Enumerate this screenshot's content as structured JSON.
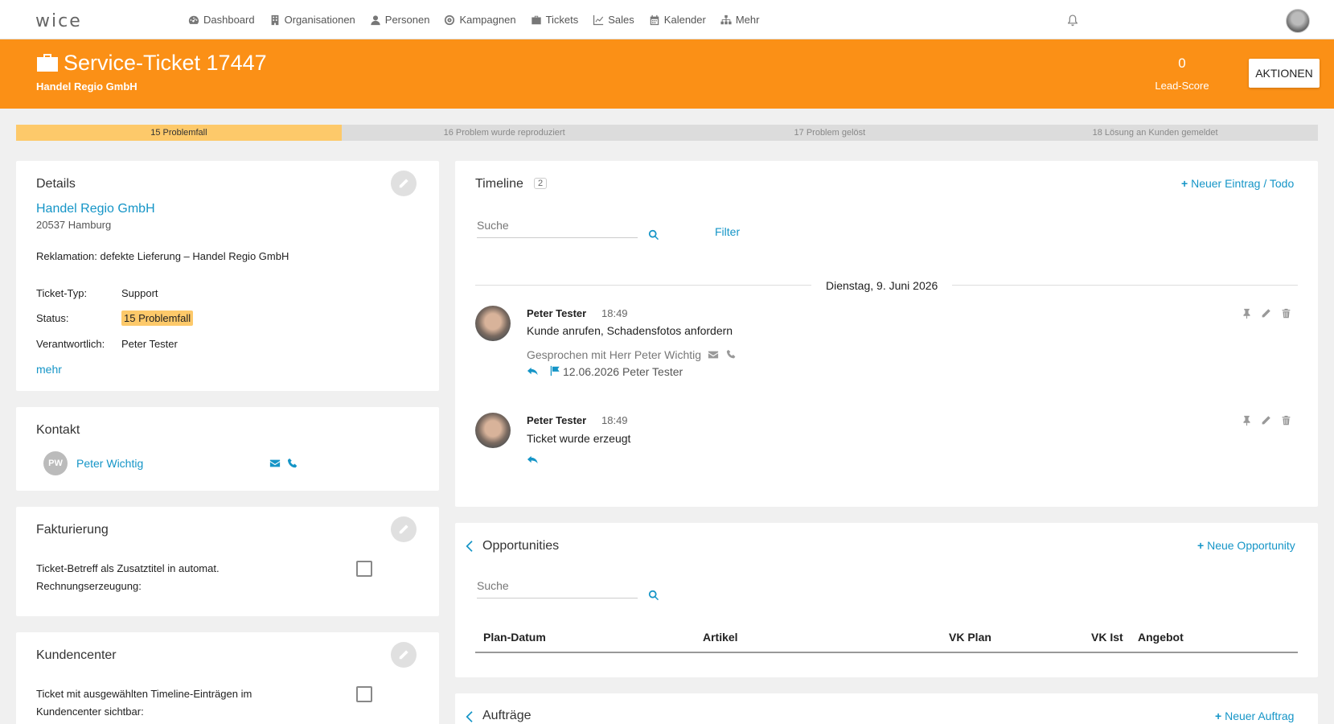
{
  "app": {
    "logo": "wice"
  },
  "nav": [
    {
      "label": "Dashboard",
      "icon": "dashboard-icon"
    },
    {
      "label": "Organisationen",
      "icon": "building-icon"
    },
    {
      "label": "Personen",
      "icon": "person-icon"
    },
    {
      "label": "Kampagnen",
      "icon": "target-icon"
    },
    {
      "label": "Tickets",
      "icon": "briefcase-icon"
    },
    {
      "label": "Sales",
      "icon": "chart-icon"
    },
    {
      "label": "Kalender",
      "icon": "calendar-icon"
    },
    {
      "label": "Mehr",
      "icon": "sitemap-icon"
    }
  ],
  "header": {
    "title": "Service-Ticket 17447",
    "subtitle": "Handel Regio GmbH",
    "lead_score_value": "0",
    "lead_score_label": "Lead-Score",
    "actions_label": "AKTIONEN",
    "accent": "#fb9016"
  },
  "stages": [
    {
      "label": "15 Problemfall",
      "active": true
    },
    {
      "label": "16 Problem wurde reproduziert",
      "active": false
    },
    {
      "label": "17 Problem gelöst",
      "active": false
    },
    {
      "label": "18 Lösung an Kunden gemeldet",
      "active": false
    }
  ],
  "details": {
    "title": "Details",
    "org_name": "Handel Regio GmbH",
    "org_address": "20537 Hamburg",
    "subject": "Reklamation: defekte Lieferung – Handel Regio GmbH",
    "type_label": "Ticket-Typ:",
    "type_value": "Support",
    "status_label": "Status:",
    "status_value": "15 Problemfall",
    "responsible_label": "Verantwortlich:",
    "responsible_value": "Peter Tester",
    "more_link": "mehr"
  },
  "contact": {
    "title": "Kontakt",
    "initials": "PW",
    "name": "Peter Wichtig"
  },
  "billing": {
    "title": "Fakturierung",
    "line1": "Ticket-Betreff als Zusatztitel in automat.",
    "line2": "Rechnungserzeugung:"
  },
  "customer_center": {
    "title": "Kundencenter",
    "line1": "Ticket mit ausgewählten Timeline-Einträgen im",
    "line2": "Kundencenter sichtbar:"
  },
  "timeline": {
    "title": "Timeline",
    "count": "2",
    "new_entry": "Neuer Eintrag / Todo",
    "search_placeholder": "Suche",
    "filter": "Filter",
    "date_divider": "Dienstag, 9. Juni 2026",
    "entries": [
      {
        "author": "Peter Tester",
        "time": "18:49",
        "text": "Kunde anrufen, Schadensfotos anfordern",
        "note": "Gesprochen mit Herr Peter Wichtig",
        "flag": "12.06.2026 Peter Tester"
      },
      {
        "author": "Peter Tester",
        "time": "18:49",
        "text": "Ticket wurde erzeugt"
      }
    ]
  },
  "opportunities": {
    "title": "Opportunities",
    "new_label": "Neue Opportunity",
    "search_placeholder": "Suche",
    "columns": [
      "Plan-Datum",
      "Artikel",
      "VK Plan",
      "VK Ist",
      "Angebot"
    ]
  },
  "orders": {
    "title": "Aufträge",
    "new_label": "Neuer Auftrag"
  }
}
